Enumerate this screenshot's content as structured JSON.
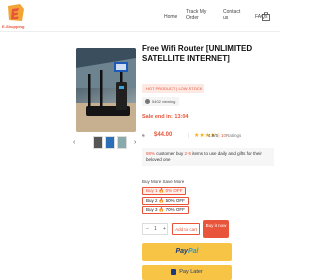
{
  "header": {
    "logo_text": "E-Shopping",
    "nav": [
      {
        "label": "Home"
      },
      {
        "label": "Track My Order"
      },
      {
        "label": "Contact us"
      },
      {
        "label": "FAQs"
      }
    ],
    "cart_count": "0"
  },
  "product": {
    "title": "Free Wifi Router [UNLIMITED SATELLITE INTERNET]",
    "hot_badge": "HOT PRODUCT | LOW STOCK",
    "views": "5402 viewing",
    "sale_label": "Sale end in",
    "sale_timer": "13:04",
    "old_price": "$",
    "new_price": "$44.00",
    "rating_stars": "★★★★☆",
    "rating_value": "4.9",
    "ratings_count": "10",
    "ratings_label": "Ratings",
    "promo_prefix": "98%",
    "promo_text": " customer buy ",
    "promo_highlight": "2-5",
    "promo_suffix": " items to use daily and gifts for their beloved one"
  },
  "bundle": {
    "title": "Buy More Save More",
    "options": [
      {
        "label": "Buy 1 🔥 0% OFF"
      },
      {
        "label": "Buy 2 🔥 50% OFF"
      },
      {
        "label": "Buy 3 🔥 70% OFF"
      }
    ]
  },
  "cart": {
    "qty_minus": "−",
    "qty_value": "1",
    "qty_plus": "+",
    "add_label": "Add to cart",
    "buy_label": "Buy it now"
  },
  "payment": {
    "paypal_1": "Pay",
    "paypal_2": "Pal",
    "paylater": "Pay Later"
  },
  "colors": {
    "accent": "#e8553a",
    "paypal_yellow": "#f7c445"
  }
}
